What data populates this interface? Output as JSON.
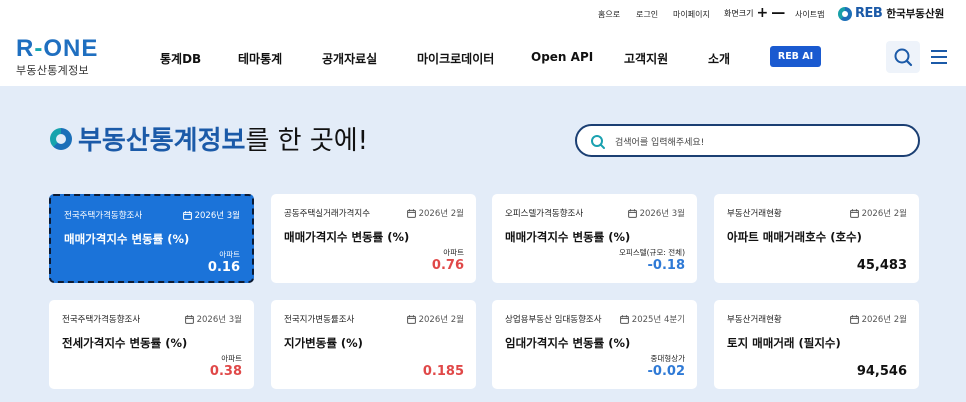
{
  "util": {
    "home": "홈으로",
    "login": "로그인",
    "mypage": "마이페이지",
    "zoom": "화면크기",
    "zoom_plus": "+",
    "zoom_minus": "—",
    "sitemap": "사이트맵",
    "org_logo_text": "REB",
    "org_name": "한국부동산원"
  },
  "logo": {
    "main_left": "R",
    "main_dash": "-",
    "main_right": "ONE",
    "sub": "부동산통계정보"
  },
  "nav": {
    "items": [
      {
        "label": "통계DB"
      },
      {
        "label": "테마통계"
      },
      {
        "label": "공개자료실"
      },
      {
        "label": "마이크로데이터"
      },
      {
        "label": "Open API"
      },
      {
        "label": "고객지원"
      },
      {
        "label": "소개"
      }
    ],
    "reb_ai": "REB AI",
    "search_icon": "search-icon",
    "menu_icon": "hamburger-menu-icon"
  },
  "hero": {
    "title_highlight": "부동산통계정보",
    "title_rest": "를 한 곳에!",
    "search_placeholder": "검색어를 입력해주세요!"
  },
  "cards": [
    {
      "source": "전국주택가격동향조사",
      "date": "2026년 3월",
      "title": "매매가격지수 변동률 (%)",
      "sub": "아파트",
      "value": "0.16",
      "trend": "up",
      "active": true
    },
    {
      "source": "공동주택실거래가격지수",
      "date": "2026년 2월",
      "title": "매매가격지수 변동률 (%)",
      "sub": "아파트",
      "value": "0.76",
      "trend": "up",
      "active": false
    },
    {
      "source": "오피스텔가격동향조사",
      "date": "2026년 3월",
      "title": "매매가격지수 변동률 (%)",
      "sub": "오피스텔(규모: 전체)",
      "value": "-0.18",
      "trend": "down",
      "active": false
    },
    {
      "source": "부동산거래현황",
      "date": "2026년 2월",
      "title": "아파트 매매거래호수 (호수)",
      "sub": "",
      "value": "45,483",
      "trend": "neutral",
      "active": false
    },
    {
      "source": "전국주택가격동향조사",
      "date": "2026년 3월",
      "title": "전세가격지수 변동률 (%)",
      "sub": "아파트",
      "value": "0.38",
      "trend": "up",
      "active": false
    },
    {
      "source": "전국지가변동률조사",
      "date": "2026년 2월",
      "title": "지가변동률 (%)",
      "sub": "",
      "value": "0.185",
      "trend": "up",
      "active": false
    },
    {
      "source": "상업용부동산 임대동향조사",
      "date": "2025년 4분기",
      "title": "임대가격지수 변동률 (%)",
      "sub": "중대형상가",
      "value": "-0.02",
      "trend": "down",
      "active": false
    },
    {
      "source": "부동산거래현황",
      "date": "2026년 2월",
      "title": "토지 매매거래 (필지수)",
      "sub": "",
      "value": "94,546",
      "trend": "neutral",
      "active": false
    }
  ],
  "colors": {
    "brand_blue": "#1b5aa8",
    "active_card": "#1b73d9",
    "up": "#e04848",
    "down": "#2f7ad6",
    "ai_button": "#1a5ad0"
  }
}
